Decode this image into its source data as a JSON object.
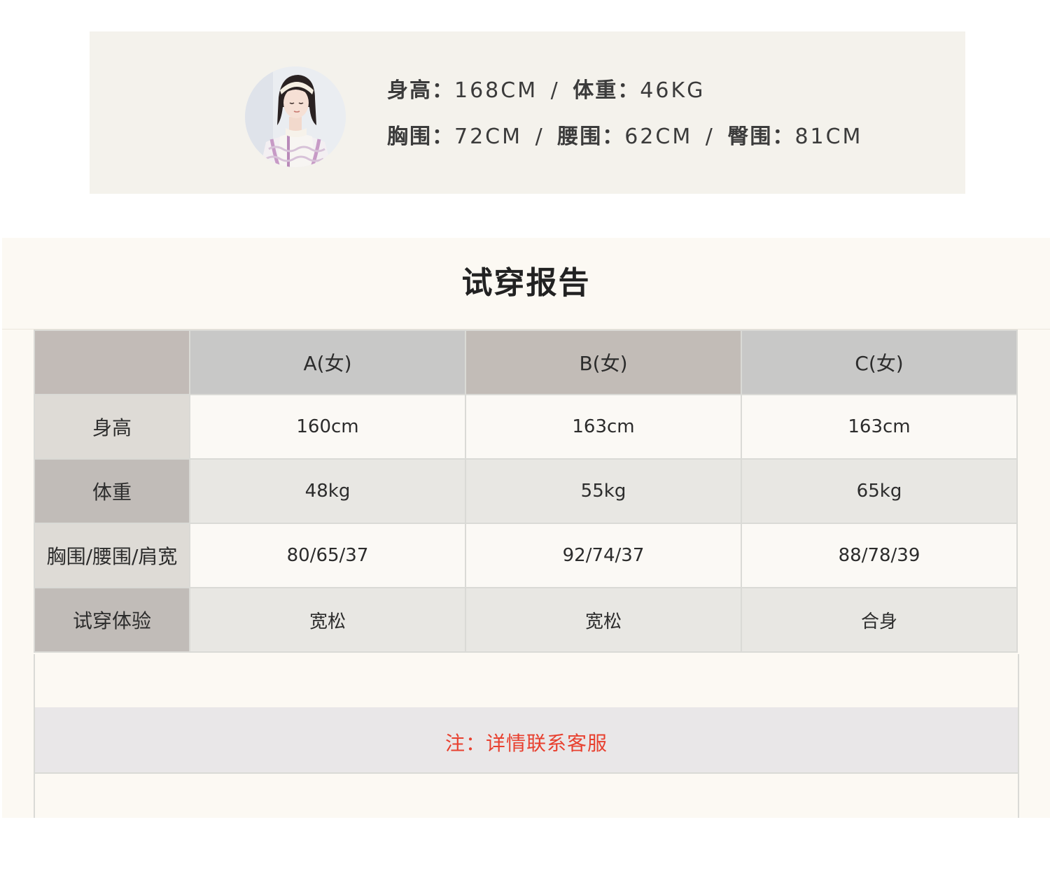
{
  "model": {
    "line1": [
      {
        "label": "身高：",
        "value": "168CM"
      },
      {
        "label": "体重：",
        "value": "46KG"
      }
    ],
    "line2": [
      {
        "label": "胸围：",
        "value": "72CM"
      },
      {
        "label": "腰围：",
        "value": "62CM"
      },
      {
        "label": "臀围：",
        "value": "81CM"
      }
    ],
    "separator": "/"
  },
  "report": {
    "title": "试穿报告",
    "columns": [
      "",
      "A(女)",
      "B(女)",
      "C(女)"
    ],
    "rows": [
      {
        "label": "身高",
        "values": [
          "160cm",
          "163cm",
          "163cm"
        ]
      },
      {
        "label": "体重",
        "values": [
          "48kg",
          "55kg",
          "65kg"
        ]
      },
      {
        "label": "胸围/腰围/肩宽",
        "values": [
          "80/65/37",
          "92/74/37",
          "88/78/39"
        ]
      },
      {
        "label": "试穿体验",
        "values": [
          "宽松",
          "宽松",
          "合身"
        ]
      }
    ],
    "note": "注：详情联系客服"
  },
  "colors": {
    "note": "#e8402f",
    "banner_bg": "#f4f2ec",
    "report_bg": "#fcf9f3"
  }
}
